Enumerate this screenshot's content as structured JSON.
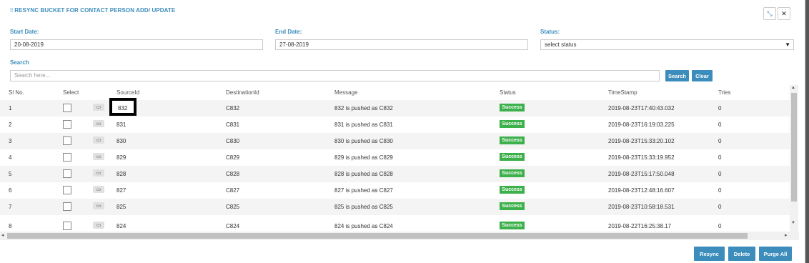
{
  "modal": {
    "title": "RESYNC BUCKET FOR CONTACT PERSON ADD/ UPDATE"
  },
  "filters": {
    "start_label": "Start Date:",
    "start_value": "20-08-2019",
    "end_label": "End Date:",
    "end_value": "27-08-2019",
    "status_label": "Status:",
    "status_value": "select status",
    "search_label": "Search",
    "search_placeholder": "Search here..."
  },
  "buttons": {
    "search": "Search",
    "clear": "Clear",
    "resync": "Resync",
    "delete": "Delete",
    "purge": "Purge All"
  },
  "columns": [
    "Sl No.",
    "Select",
    "SourceId",
    "DestinationId",
    "Message",
    "Status",
    "TimeStamp",
    "Tries"
  ],
  "rows": [
    {
      "no": "1",
      "source": "832",
      "dest": "C832",
      "message": "832 is pushed as C832",
      "status": "Success",
      "ts": "2019-08-23T17:40:43.032",
      "tries": "0"
    },
    {
      "no": "2",
      "source": "831",
      "dest": "C831",
      "message": "831 is pushed as C831",
      "status": "Success",
      "ts": "2019-08-23T16:19:03.225",
      "tries": "0"
    },
    {
      "no": "3",
      "source": "830",
      "dest": "C830",
      "message": "830 is pushed as C830",
      "status": "Success",
      "ts": "2019-08-23T15:33:20.102",
      "tries": "0"
    },
    {
      "no": "4",
      "source": "829",
      "dest": "C829",
      "message": "829 is pushed as C829",
      "status": "Success",
      "ts": "2019-08-23T15:33:19.952",
      "tries": "0"
    },
    {
      "no": "5",
      "source": "828",
      "dest": "C828",
      "message": "828 is pushed as C828",
      "status": "Success",
      "ts": "2019-08-23T15:17:50.048",
      "tries": "0"
    },
    {
      "no": "6",
      "source": "827",
      "dest": "C827",
      "message": "827 is pushed as C827",
      "status": "Success",
      "ts": "2019-08-23T12:48:16.607",
      "tries": "0"
    },
    {
      "no": "7",
      "source": "825",
      "dest": "C825",
      "message": "825 is pushed as C825",
      "status": "Success",
      "ts": "2019-08-23T10:58:18.531",
      "tries": "0"
    },
    {
      "no": "8",
      "source": "824",
      "dest": "C824",
      "message": "824 is pushed as C824",
      "status": "Success",
      "ts": "2019-08-22T16:25:38.17",
      "tries": "0"
    }
  ],
  "colors": {
    "accent": "#3c8dbc",
    "success": "#3cb04a"
  }
}
